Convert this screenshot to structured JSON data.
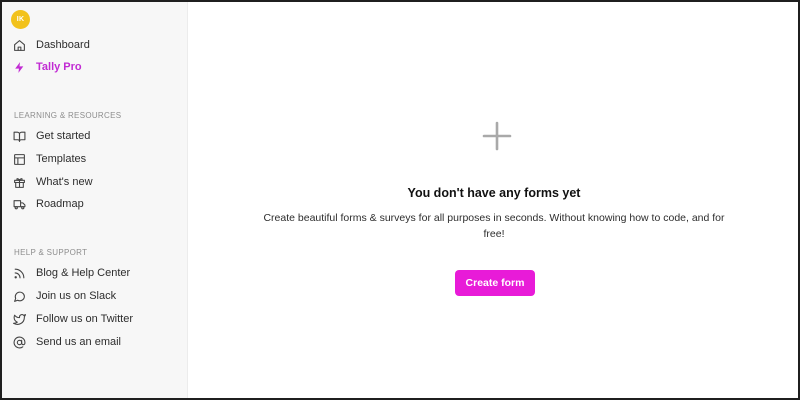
{
  "user": {
    "avatar_initials": "IK",
    "avatar_color": "#f2c21b"
  },
  "sidebar": {
    "top_items": [
      {
        "label": "Dashboard",
        "icon": "home-icon"
      },
      {
        "label": "Tally Pro",
        "icon": "lightning-icon"
      }
    ],
    "sections": [
      {
        "title": "LEARNING & RESOURCES",
        "items": [
          {
            "label": "Get started",
            "icon": "book-icon"
          },
          {
            "label": "Templates",
            "icon": "layout-icon"
          },
          {
            "label": "What's new",
            "icon": "gift-icon"
          },
          {
            "label": "Roadmap",
            "icon": "truck-icon"
          }
        ]
      },
      {
        "title": "HELP & SUPPORT",
        "items": [
          {
            "label": "Blog & Help Center",
            "icon": "rss-icon"
          },
          {
            "label": "Join us on Slack",
            "icon": "chat-bubble-icon"
          },
          {
            "label": "Follow us on Twitter",
            "icon": "twitter-icon"
          },
          {
            "label": "Send us an email",
            "icon": "at-sign-icon"
          }
        ]
      }
    ]
  },
  "main": {
    "empty_state": {
      "icon": "plus-icon",
      "title": "You don't have any forms yet",
      "description": "Create beautiful forms & surveys for all purposes in seconds. Without knowing how to code, and for free!",
      "button_label": "Create form"
    }
  },
  "colors": {
    "accent": "#e81bd8",
    "pro": "#c12bd3",
    "sidebar_bg": "#f7f7f7"
  }
}
